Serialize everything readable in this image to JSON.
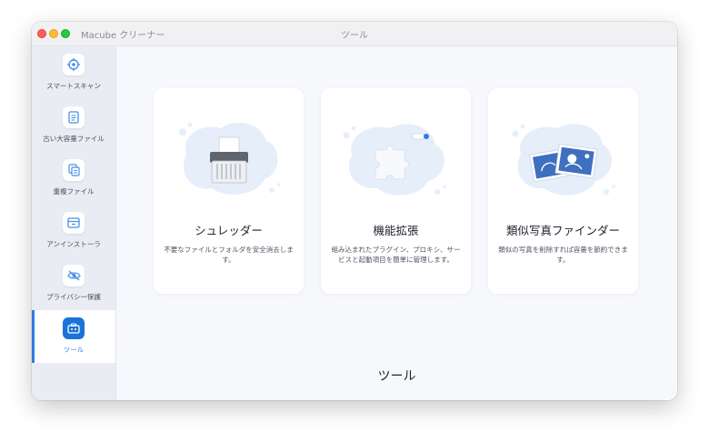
{
  "window": {
    "app_name": "Macube クリーナー",
    "title": "ツール"
  },
  "sidebar": {
    "items": [
      {
        "label": "スマートスキャン",
        "icon": "target-icon"
      },
      {
        "label": "古い大容量ファイル",
        "icon": "document-icon"
      },
      {
        "label": "重複ファイル",
        "icon": "copy-icon"
      },
      {
        "label": "アンインストーラ",
        "icon": "box-icon"
      },
      {
        "label": "プライバシー保護",
        "icon": "eye-slash-icon"
      },
      {
        "label": "ツール",
        "icon": "toolbox-icon",
        "active": true
      }
    ]
  },
  "cards": [
    {
      "title": "シュレッダー",
      "description": "不要なファイルとフォルダを安全消去します。",
      "icon": "shredder-icon"
    },
    {
      "title": "機能拡張",
      "description": "組み込まれたプラグイン、プロキシ、サービスと起動項目を簡単に管理します。",
      "icon": "puzzle-icon"
    },
    {
      "title": "類似写真ファインダー",
      "description": "類似の写真を削除すれば容量を節約できます。",
      "icon": "photos-icon"
    }
  ],
  "section_title": "ツール",
  "colors": {
    "accent": "#2f7de1",
    "sidebar_bg": "#e9ecf3",
    "content_bg": "#f6f8fc",
    "card_bg": "#ffffff"
  }
}
